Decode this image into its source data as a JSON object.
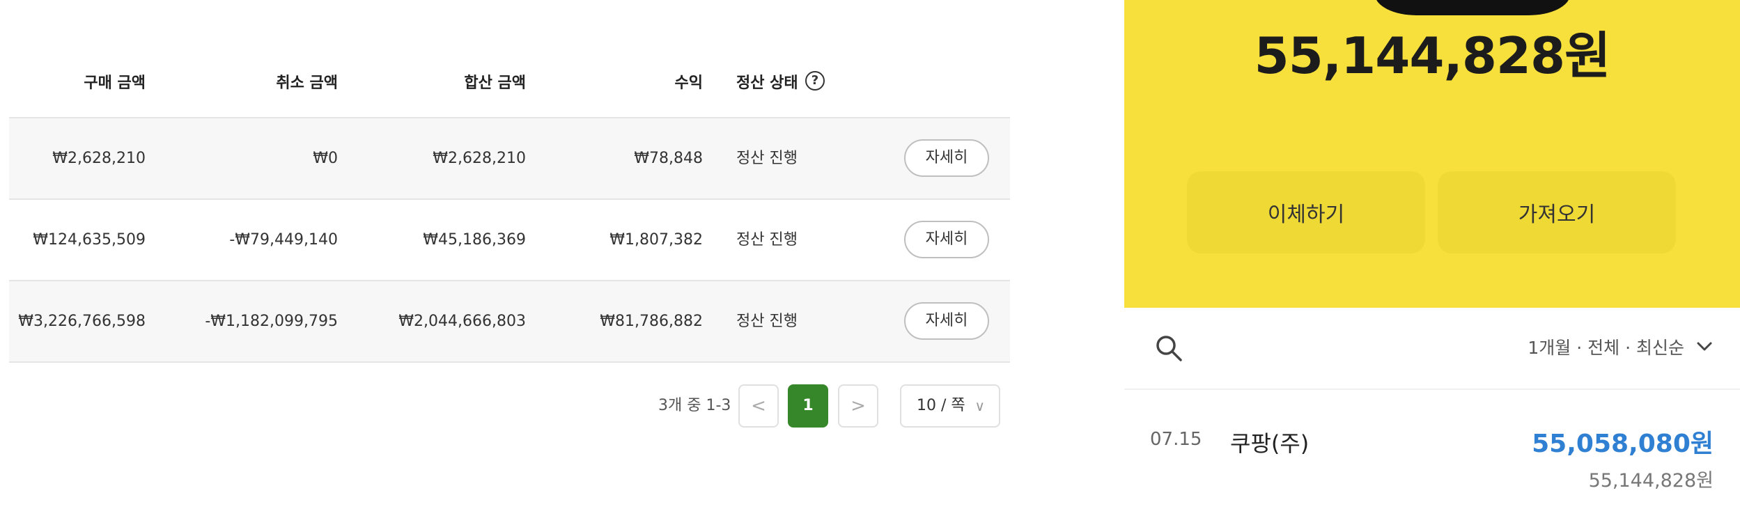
{
  "table": {
    "headers": {
      "purchase": "구매 금액",
      "cancel": "취소 금액",
      "total": "합산 금액",
      "profit": "수익",
      "status": "정산 상태"
    },
    "help_icon": "question-circle-icon",
    "rows": [
      {
        "purchase": "₩2,628,210",
        "cancel": "₩0",
        "total": "₩2,628,210",
        "profit": "₩78,848",
        "status": "정산 진행",
        "action": "자세히"
      },
      {
        "purchase": "₩124,635,509",
        "cancel": "-₩79,449,140",
        "total": "₩45,186,369",
        "profit": "₩1,807,382",
        "status": "정산 진행",
        "action": "자세히"
      },
      {
        "purchase": "₩3,226,766,598",
        "cancel": "-₩1,182,099,795",
        "total": "₩2,044,666,803",
        "profit": "₩81,786,882",
        "status": "정산 진행",
        "action": "자세히"
      }
    ]
  },
  "pagination": {
    "count_text": "3개 중 1-3",
    "prev": "<",
    "current_page": "1",
    "next": ">",
    "page_size": "10 / 쪽"
  },
  "account": {
    "balance": "55,144,828원",
    "transfer_label": "이체하기",
    "fetch_label": "가져오기",
    "filter_text": "1개월 · 전체 · 최신순",
    "transaction": {
      "date": "07.15",
      "name": "쿠팡(주)",
      "amount": "55,058,080원",
      "balance_after": "55,144,828원"
    }
  },
  "colors": {
    "accent_green": "#36862a",
    "panel_yellow": "#f7e03c",
    "amount_blue": "#2f7fd3"
  }
}
